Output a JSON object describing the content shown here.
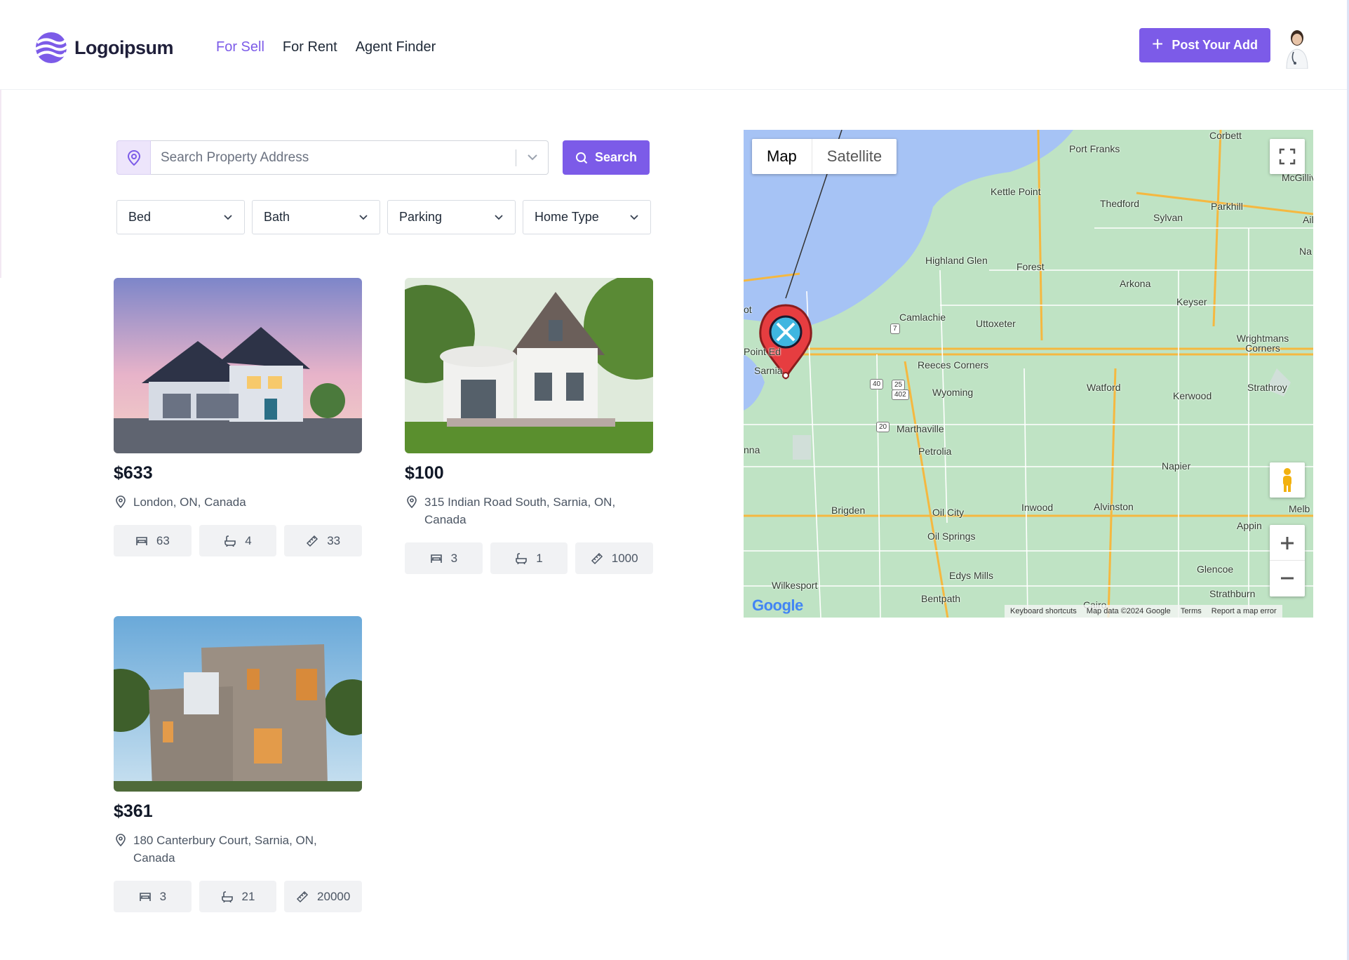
{
  "header": {
    "logo_text": "Logoipsum",
    "nav": [
      {
        "label": "For Sell",
        "active": true
      },
      {
        "label": "For Rent",
        "active": false
      },
      {
        "label": "Agent Finder",
        "active": false
      }
    ],
    "post_button_label": "Post Your Add",
    "accent_color": "#7c5be8"
  },
  "search": {
    "placeholder": "Search Property Address",
    "value": "",
    "button_label": "Search"
  },
  "filters": [
    {
      "label": "Bed"
    },
    {
      "label": "Bath"
    },
    {
      "label": "Parking"
    },
    {
      "label": "Home Type"
    }
  ],
  "listings": [
    {
      "price": "$633",
      "address": "London, ON, Canada",
      "beds": "63",
      "baths": "4",
      "area": "33",
      "image": "suburban-house-dusk"
    },
    {
      "price": "$100",
      "address": "315 Indian Road South, Sarnia, ON, Canada",
      "beds": "3",
      "baths": "1",
      "area": "1000",
      "image": "white-victorian-house"
    },
    {
      "price": "$361",
      "address": "180 Canterbury Court, Sarnia, ON, Canada",
      "beds": "3",
      "baths": "21",
      "area": "20000",
      "image": "modern-brick-house"
    }
  ],
  "map": {
    "types": [
      {
        "label": "Map",
        "active": true
      },
      {
        "label": "Satellite",
        "active": false
      }
    ],
    "places": [
      "Corbett",
      "Port Franks",
      "McGillivr",
      "Kettle Point",
      "Thedford",
      "Sylvan",
      "Parkhill",
      "Highland Glen",
      "Forest",
      "Arkona",
      "Keyser",
      "Camlachie",
      "Uttoxeter",
      "Wrightmans Corners",
      "Point Ed",
      "Sarnia",
      "Reeces Corners",
      "Wyoming",
      "Watford",
      "Kerwood",
      "Strathroy",
      "Marthaville",
      "Petrolia",
      "Napier",
      "Brigden",
      "Oil City",
      "Inwood",
      "Alvinston",
      "Appin",
      "Oil Springs",
      "Glencoe",
      "Edys Mills",
      "Wilkesport",
      "Bentpath",
      "Strathburn",
      "Melb",
      "Na",
      "Ail",
      "nna",
      "ot",
      "Cairo"
    ],
    "footer": [
      "Keyboard shortcuts",
      "Map data ©2024 Google",
      "Terms",
      "Report a map error"
    ],
    "attribution": "Google",
    "water_color": "#a6c3f5",
    "land_color": "#bfe3c4"
  }
}
